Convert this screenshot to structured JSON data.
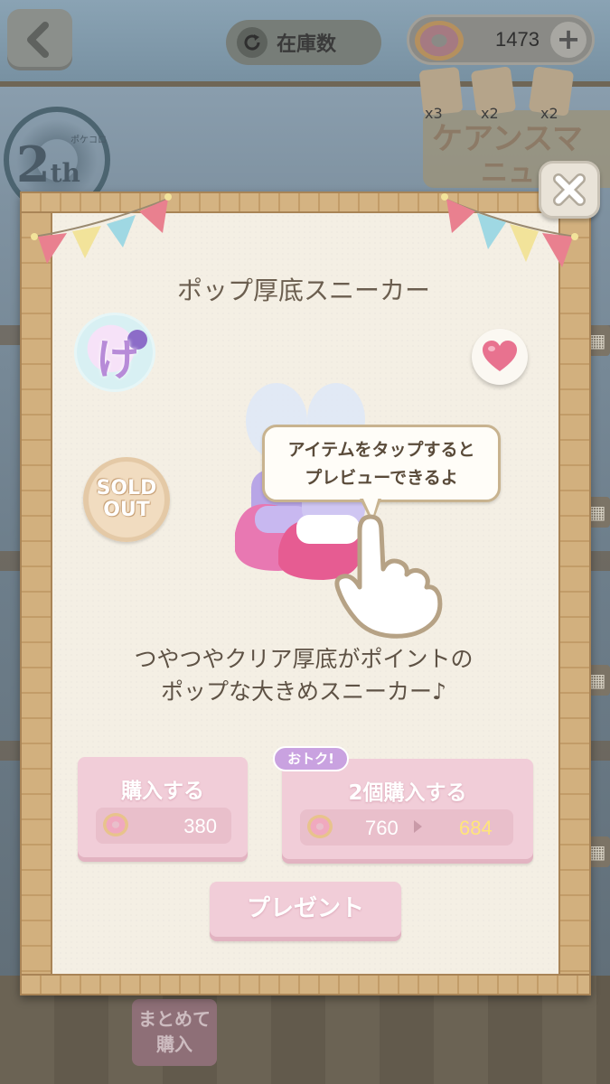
{
  "top_bar": {
    "stock_label": "在庫数",
    "currency_value": "1473",
    "plus_symbol": "+"
  },
  "background": {
    "anniversary_num": "2",
    "anniversary_suffix": "th",
    "anniversary_small": "ポケコロ",
    "banner_line1": "ケアンスマ",
    "banner_line2": "ニュ",
    "card_counts": [
      "x3",
      "x2",
      "x2"
    ],
    "bulk_buy_label_1": "まとめて",
    "bulk_buy_label_2": "購入"
  },
  "dialog": {
    "item_name": "ポップ厚底スニーカー",
    "tag_char": "け",
    "sold_out_line1": "SOLD",
    "sold_out_line2": "OUT",
    "tooltip_line1": "アイテムをタップすると",
    "tooltip_line2": "プレビューできるよ",
    "description_line1": "つやつやクリア厚底がポイントの",
    "description_line2": "ポップな大きめスニーカー♪",
    "buy_one": {
      "label": "購入する",
      "price": "380"
    },
    "buy_two": {
      "label": "2個購入する",
      "price_original": "760",
      "price_discount": "684",
      "badge": "おトク!"
    },
    "present_label": "プレゼント"
  },
  "colors": {
    "button_pink": "#f1cdd8",
    "discount_yellow": "#ffe57a",
    "heart": "#e8728f"
  },
  "icons": [
    "back-arrow-icon",
    "refresh-icon",
    "donut-icon",
    "plus-icon",
    "close-icon",
    "heart-icon",
    "tap-hand-icon"
  ]
}
